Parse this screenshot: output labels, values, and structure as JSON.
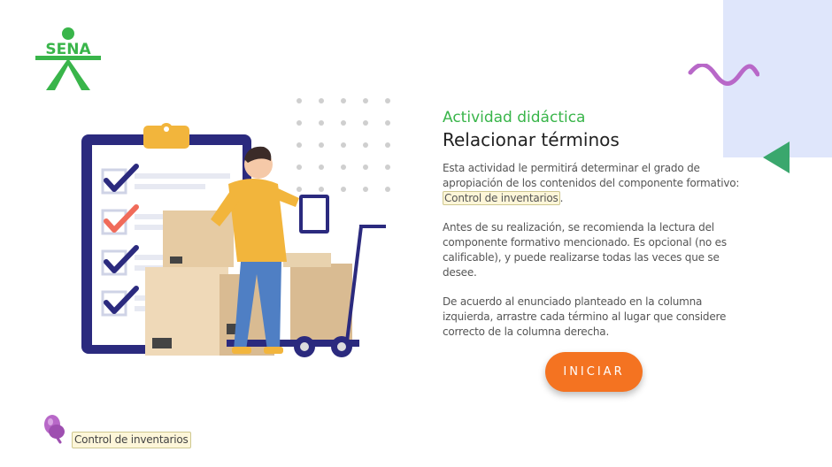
{
  "brand": {
    "logo_text": "SENA",
    "color": "#39b54a"
  },
  "activity": {
    "subtitle": "Actividad didáctica",
    "title": "Relacionar términos",
    "para1_a": "Esta actividad le permitirá determinar el grado de apropiación de los contenidos del componente formativo: ",
    "para1_highlight": "Control de inventarios",
    "para1_b": ".",
    "para2": "Antes de su realización, se recomienda la lectura del componente formativo mencionado.  Es opcional (no es calificable), y puede realizarse todas las veces que se desee.",
    "para3": "De acuerdo al enunciado planteado en la columna izquierda, arrastre cada término al lugar que considere correcto de la columna derecha."
  },
  "start_button": {
    "label": "INICIAR",
    "color": "#f47321"
  },
  "reference": {
    "icon": "pin-icon",
    "label": "Control de inventarios"
  },
  "colors": {
    "accent_green": "#39b54a",
    "accent_orange": "#f47321",
    "accent_purple": "#b868c8",
    "panel_blue": "#dfe6fb",
    "navy": "#2b2a7e"
  }
}
